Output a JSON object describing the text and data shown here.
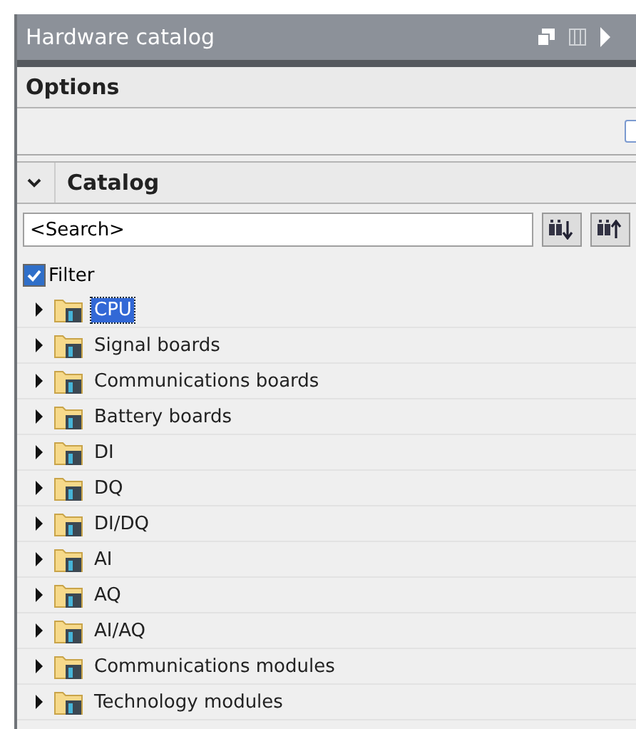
{
  "window": {
    "title": "Hardware catalog"
  },
  "options": {
    "title": "Options"
  },
  "catalog": {
    "title": "Catalog",
    "expanded": true
  },
  "search": {
    "placeholder": "<Search>"
  },
  "filter": {
    "label": "Filter",
    "checked": true
  },
  "tree": [
    {
      "label": "CPU",
      "selected": true,
      "expanded": false
    },
    {
      "label": "Signal boards",
      "selected": false,
      "expanded": false
    },
    {
      "label": "Communications boards",
      "selected": false,
      "expanded": false
    },
    {
      "label": "Battery boards",
      "selected": false,
      "expanded": false
    },
    {
      "label": "DI",
      "selected": false,
      "expanded": false
    },
    {
      "label": "DQ",
      "selected": false,
      "expanded": false
    },
    {
      "label": "DI/DQ",
      "selected": false,
      "expanded": false
    },
    {
      "label": "AI",
      "selected": false,
      "expanded": false
    },
    {
      "label": "AQ",
      "selected": false,
      "expanded": false
    },
    {
      "label": "AI/AQ",
      "selected": false,
      "expanded": false
    },
    {
      "label": "Communications modules",
      "selected": false,
      "expanded": false
    },
    {
      "label": "Technology modules",
      "selected": false,
      "expanded": false
    }
  ]
}
